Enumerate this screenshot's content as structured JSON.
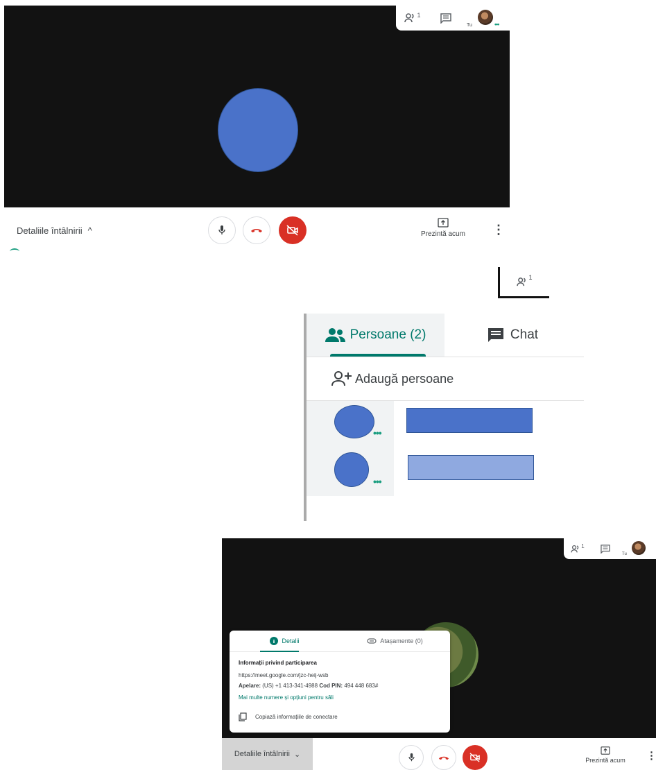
{
  "call_top": {
    "topbar": {
      "people_count": "1",
      "you_label": "Tu",
      "status_dots": "•••"
    },
    "footer": {
      "details_label": "Detaliile întâlnirii",
      "details_chevron": "^",
      "present_label": "Prezintă acum",
      "more_label": "⋮"
    },
    "participant_color": "#4a72c9"
  },
  "people_zoom": {
    "people_count": "1"
  },
  "panel": {
    "tabs": [
      {
        "label": "Persoane (2)",
        "icon": "people-icon",
        "active": true
      },
      {
        "label": "Chat",
        "icon": "chat-icon",
        "active": false
      }
    ],
    "add_people_label": "Adaugă persoane",
    "participants": [
      {
        "status_dots": "•••",
        "name_color": "#4a72c9"
      },
      {
        "status_dots": "•••",
        "name_color": "#8fa9e0"
      }
    ],
    "accent_color": "#00796b"
  },
  "call_bottom": {
    "topbar": {
      "people_count": "1",
      "you_label": "Tu"
    },
    "details_card": {
      "tabs": [
        {
          "label": "Detalii",
          "icon": "info-icon",
          "active": true
        },
        {
          "label": "Atașamente (0)",
          "icon": "attachment-icon",
          "active": false
        }
      ],
      "section_title": "Informații privind participarea",
      "meeting_url": "https://meet.google.com/jzc-heij-wsb",
      "dial_label": "Apelare:",
      "dial_value": "(US) +1 413-341-4988",
      "pin_label": "Cod PIN:",
      "pin_value": "494 448 683#",
      "more_numbers_link": "Mai multe numere și opțiuni pentru săli",
      "copy_label": "Copiază informațiile de conectare"
    },
    "footer": {
      "details_label": "Detaliile întâlnirii",
      "details_chevron": "⌄",
      "present_label": "Prezintă acum",
      "more_label": "⋮"
    }
  }
}
